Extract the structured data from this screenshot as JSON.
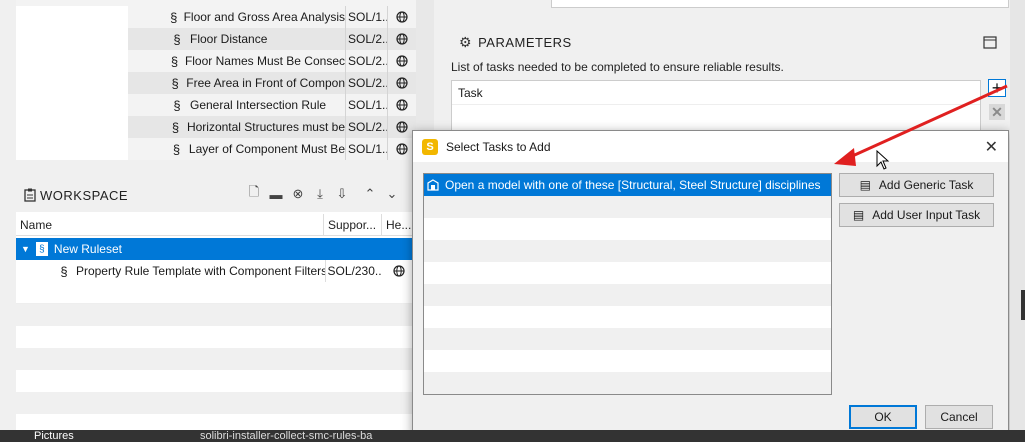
{
  "rule_list": {
    "rows": [
      {
        "name": "Floor and Gross Area Analysis",
        "support": "SOL/1...",
        "alt": false
      },
      {
        "name": "Floor Distance",
        "support": "SOL/2...",
        "alt": true
      },
      {
        "name": "Floor Names Must Be Consec",
        "support": "SOL/2...",
        "alt": false
      },
      {
        "name": "Free Area in Front of Compon",
        "support": "SOL/2...",
        "alt": true
      },
      {
        "name": "General Intersection Rule",
        "support": "SOL/1...",
        "alt": false
      },
      {
        "name": "Horizontal Structures must be",
        "support": "SOL/2...",
        "alt": true
      },
      {
        "name": "Layer of Component Must Be",
        "support": "SOL/1...",
        "alt": false
      }
    ]
  },
  "workspace": {
    "title": "WORKSPACE",
    "columns": {
      "name": "Name",
      "supported": "Suppor...",
      "help": "He..."
    },
    "ruleset": {
      "label": "New Ruleset"
    },
    "child": {
      "label": "Property Rule Template with Component Filters",
      "support": "SOL/230..."
    }
  },
  "parameters": {
    "title": "PARAMETERS",
    "description": "List of tasks needed to be completed to ensure reliable results.",
    "table_header": "Task"
  },
  "dialog": {
    "title": "Select Tasks to Add",
    "logo_letter": "S",
    "tasks": [
      "Open a model with one of these [Structural, Steel Structure] disciplines"
    ],
    "add_generic_label": "Add Generic Task",
    "add_user_input_label": "Add User Input Task",
    "ok_label": "OK",
    "cancel_label": "Cancel"
  },
  "taskbar": {
    "left_item": "Pictures",
    "right_item": "solibri-installer-collect-smc-rules-ba"
  },
  "colors": {
    "selection": "#0078d7",
    "arrow": "#e02020",
    "logo": "#f2b700"
  }
}
